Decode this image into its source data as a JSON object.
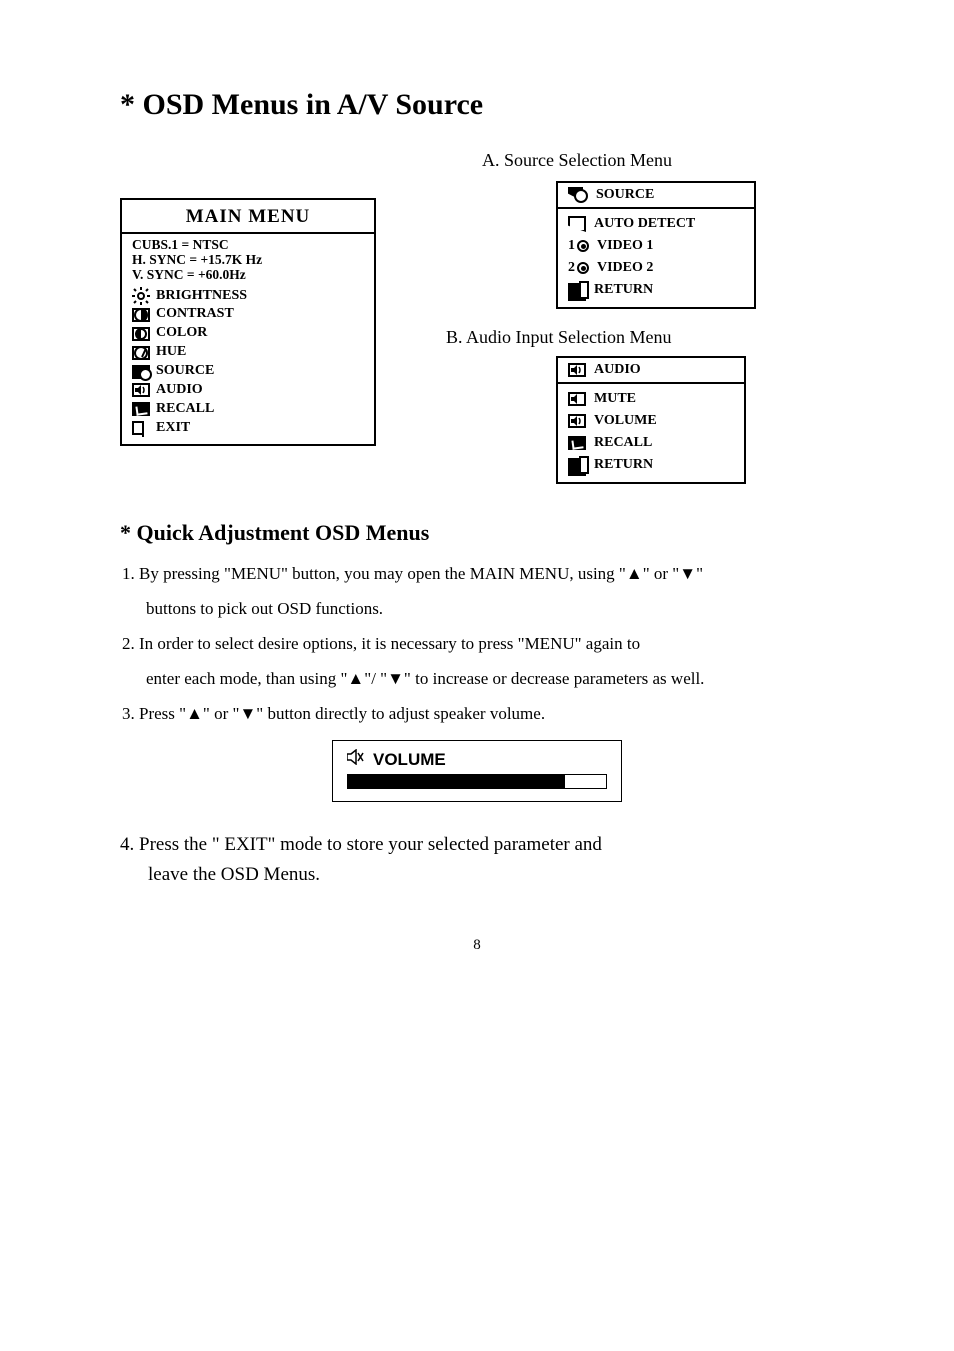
{
  "heading1": "*  OSD Menus in A/V Source",
  "submenuA": "A. Source Selection Menu",
  "submenuB": "B. Audio Input Selection Menu",
  "mainMenu": {
    "title": "MAIN MENU",
    "sync1": "CUBS.1  =  NTSC",
    "sync2": "H. SYNC =  +15.7K Hz",
    "sync3": "V. SYNC =   +60.0Hz",
    "items": {
      "brightness": "BRIGHTNESS",
      "contrast": "CONTRAST",
      "color": "COLOR",
      "hue": "HUE",
      "source": "SOURCE",
      "audio": "AUDIO",
      "recall": "RECALL",
      "exit": "EXIT"
    }
  },
  "sourceMenu": {
    "title": "SOURCE",
    "autoDetect": "AUTO DETECT",
    "video1": "VIDEO 1",
    "video2": "VIDEO 2",
    "return": "RETURN"
  },
  "audioMenu": {
    "title": "AUDIO",
    "mute": "MUTE",
    "volume": "VOLUME",
    "recall": "RECALL",
    "return": "RETURN"
  },
  "heading2": "* Quick Adjustment OSD Menus",
  "list": {
    "p1a": "1. By pressing \"MENU\" button, you may open the MAIN MENU, using \"▲\" or \"▼\"",
    "p1b": "buttons to pick out OSD functions.",
    "p2a": "2. In order to select desire options, it is necessary to press \"MENU\" again to",
    "p2b": "enter each mode, than using \"▲\"/ \"▼\" to increase or decrease parameters as well.",
    "p3": "3. Press \"▲\" or \"▼\" button directly to adjust speaker volume."
  },
  "volumeLabel": "VOLUME",
  "final": {
    "l1": "4. Press the \" EXIT\" mode to store  your selected parameter and",
    "l2": "leave the  OSD Menus."
  },
  "pageNum": "8"
}
